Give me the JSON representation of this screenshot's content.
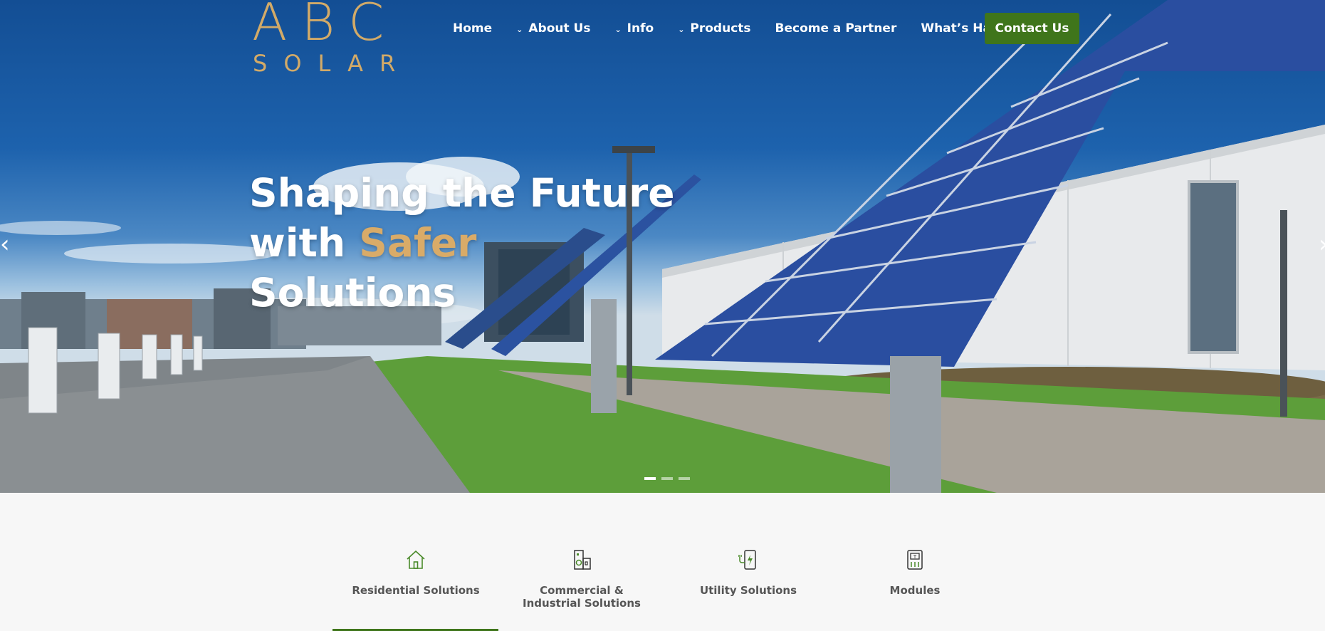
{
  "brand": {
    "logo_top": "ABC",
    "logo_bottom": "SOLAR",
    "logo_color": "#d2aa68"
  },
  "nav": {
    "home": "Home",
    "about": "About Us",
    "info": "Info",
    "products": "Products",
    "partner": "Become a Partner",
    "happening": "What’s Happening",
    "contact": "Contact Us",
    "contact_color": "#3f751b"
  },
  "hero": {
    "line1": "Shaping the Future",
    "line2_prefix": "with ",
    "line2_accent": "Safer",
    "line3": "Solutions",
    "accent_color": "#d9ab68",
    "slides": 3,
    "active_slide": 1
  },
  "solutions": {
    "active_index": 0,
    "items": [
      {
        "label": "Residential Solutions",
        "icon": "house-icon"
      },
      {
        "label": "Commercial &\nIndustrial Solutions",
        "icon": "building-icon"
      },
      {
        "label": "Utility Solutions",
        "icon": "charging-station-icon"
      },
      {
        "label": "Modules",
        "icon": "module-icon"
      }
    ],
    "accent_color": "#3f751b"
  }
}
